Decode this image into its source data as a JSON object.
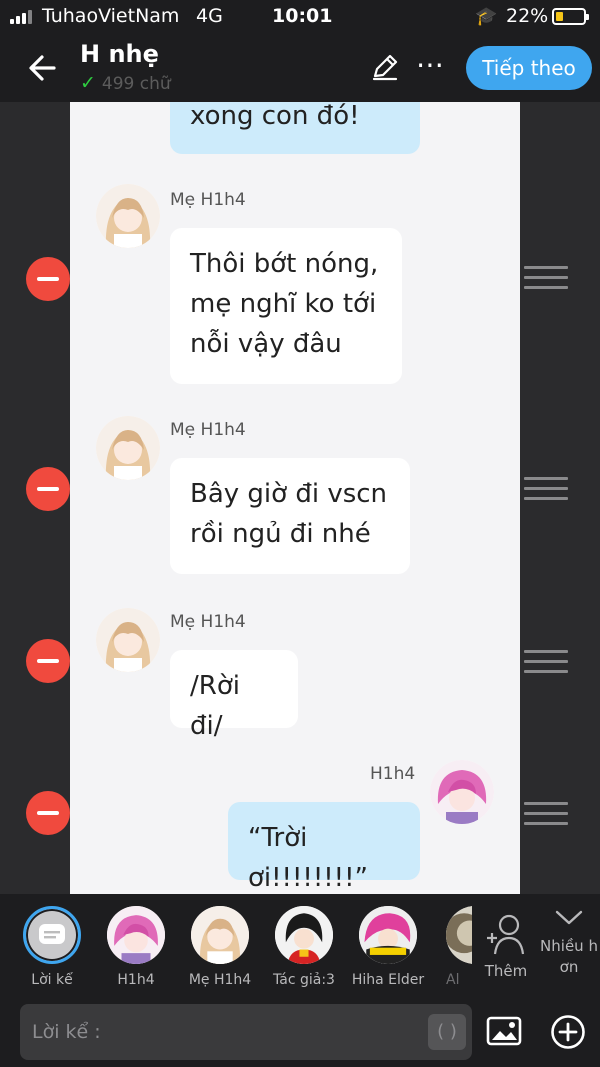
{
  "status_bar": {
    "carrier": "TuhaoVietNam",
    "network": "4G",
    "time": "10:01",
    "battery": "22%",
    "battery_level": 0.22
  },
  "header": {
    "title": "H nhẹ",
    "word_count": "499 chữ",
    "next_label": "Tiếp theo",
    "more_icon": "⋯"
  },
  "messages": [
    {
      "sender": "",
      "lines": [
        "xong con đó!"
      ],
      "mine": true
    },
    {
      "sender": "Mẹ H1h4",
      "lines": [
        "Thôi bớt nóng,",
        "mẹ nghĩ ko tới",
        "nỗi vậy đâu"
      ],
      "mine": false
    },
    {
      "sender": "Mẹ H1h4",
      "lines": [
        "Bây giờ đi vscn",
        "rồi ngủ đi nhé"
      ],
      "mine": false
    },
    {
      "sender": "Mẹ H1h4",
      "lines": [
        "/Rời đi/"
      ],
      "mine": false
    },
    {
      "sender": "H1h4",
      "lines": [
        "“Trời ơi!!!!!!!!”"
      ],
      "mine": true
    }
  ],
  "characters": [
    {
      "name": "Lời kể"
    },
    {
      "name": "H1h4"
    },
    {
      "name": "Mẹ H1h4"
    },
    {
      "name": "Tác giả:3"
    },
    {
      "name": "Hiha Elder"
    },
    {
      "name": "Al"
    }
  ],
  "add_character": {
    "label": "Thêm"
  },
  "more_characters": {
    "label_1": "Nhiều h",
    "label_2": "ơn"
  },
  "composer": {
    "placeholder": "Lời kể :",
    "bracket_label": "( )"
  },
  "colors": {
    "accent": "#3fa6ef",
    "remove": "#f04a3e",
    "my_bubble": "#cdebfb",
    "chat_bg": "#f4f4f6"
  }
}
